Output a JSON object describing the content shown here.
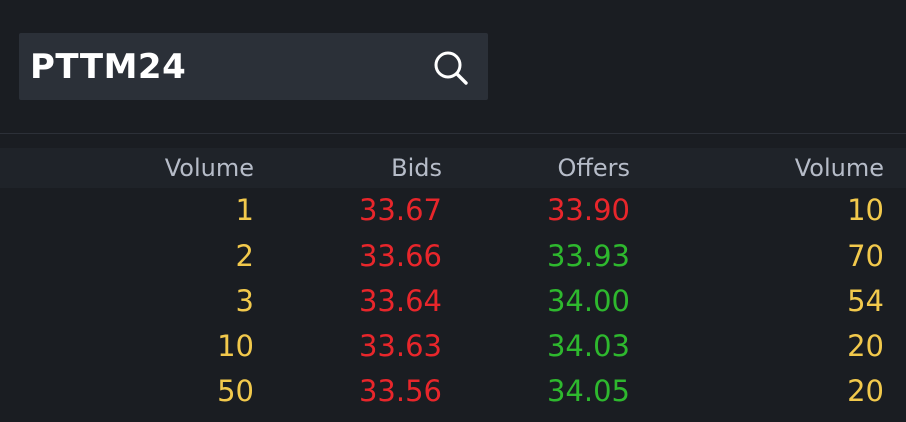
{
  "search": {
    "value": "PTTM24"
  },
  "colors": {
    "background": "#1a1d22",
    "search_bg": "#2b3038",
    "header_text": "#b6bcc8",
    "volume": "#f2c94c",
    "bid": "#e8262b",
    "offer_up": "#2eb82e",
    "offer_down": "#e8262b"
  },
  "table": {
    "headers": [
      "Volume",
      "Bids",
      "Offers",
      "Volume"
    ],
    "rows": [
      {
        "bid_volume": "1",
        "bid": "33.67",
        "offer": "33.90",
        "offer_volume": "10",
        "offer_color": "#e8262b"
      },
      {
        "bid_volume": "2",
        "bid": "33.66",
        "offer": "33.93",
        "offer_volume": "70",
        "offer_color": "#2eb82e"
      },
      {
        "bid_volume": "3",
        "bid": "33.64",
        "offer": "34.00",
        "offer_volume": "54",
        "offer_color": "#2eb82e"
      },
      {
        "bid_volume": "10",
        "bid": "33.63",
        "offer": "34.03",
        "offer_volume": "20",
        "offer_color": "#2eb82e"
      },
      {
        "bid_volume": "50",
        "bid": "33.56",
        "offer": "34.05",
        "offer_volume": "20",
        "offer_color": "#2eb82e"
      }
    ]
  }
}
